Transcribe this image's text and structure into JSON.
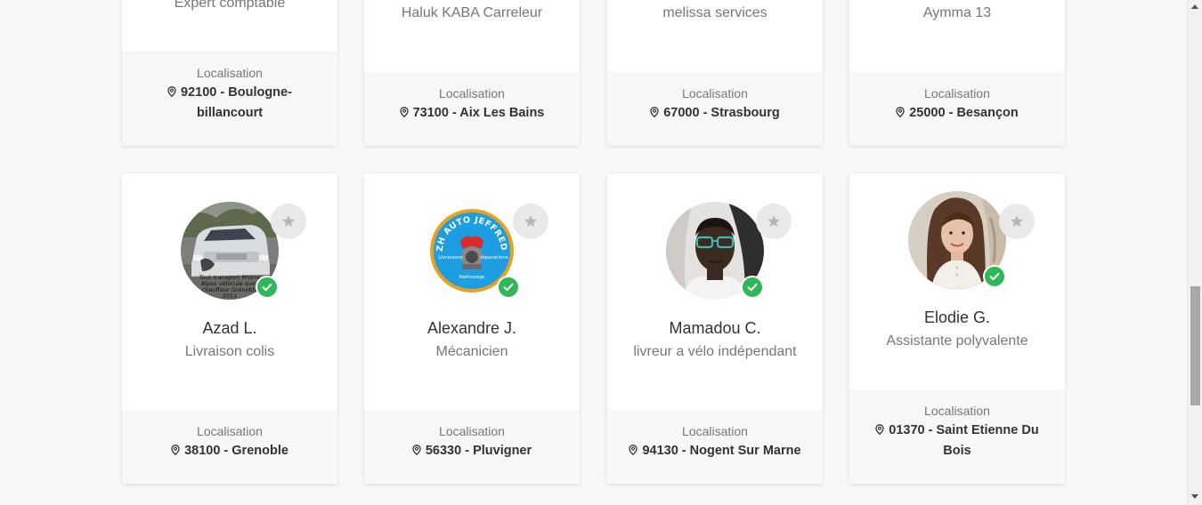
{
  "top_row": [
    {
      "subtitle": "Expert comptable",
      "loc_label": "Localisation",
      "loc_line1": "92100 - Boulogne-",
      "loc_line2": "billancourt"
    },
    {
      "subtitle": "Haluk KABA Carreleur",
      "loc_label": "Localisation",
      "loc_line1": "73100 - Aix Les Bains"
    },
    {
      "subtitle": "melissa services",
      "loc_label": "Localisation",
      "loc_line1": "67000 - Strasbourg"
    },
    {
      "subtitle": "Aymma 13",
      "loc_label": "Localisation",
      "loc_line1": "25000 - Besançon"
    }
  ],
  "bottom_row": [
    {
      "name": "Azad L.",
      "subtitle": "Livraison colis",
      "loc_label": "Localisation",
      "loc_line1": "38100 - Grenoble",
      "avatar_caption": "Tout transport Rhône Alpes véhicule avec chauffeur Grenoble 2011"
    },
    {
      "name": "Alexandre J.",
      "subtitle": "Mécanicien",
      "loc_label": "Localisation",
      "loc_line1": "56330 - Pluvigner",
      "logo_title": "BZH AUTO JEFFREDO",
      "logo_left": "Livraisons",
      "logo_right": "réparations",
      "logo_bottom": "Nettoyage"
    },
    {
      "name": "Mamadou C.",
      "subtitle": "livreur a vélo indépendant",
      "loc_label": "Localisation",
      "loc_line1": "94130 - Nogent Sur Marne"
    },
    {
      "name": "Elodie G.",
      "subtitle": "Assistante polyvalente",
      "loc_label": "Localisation",
      "loc_line1": "01370 - Saint Etienne Du",
      "loc_line2": "Bois"
    }
  ],
  "icons": {
    "favorite": "star-icon",
    "verified": "check-icon",
    "location": "map-pin-icon"
  },
  "colors": {
    "verified_green": "#2fb75a",
    "star_bg": "#e9e9e9",
    "star_fg": "#b5b5b5",
    "footer_bg": "#f7f7f7",
    "page_bg": "#f8f8f8"
  }
}
